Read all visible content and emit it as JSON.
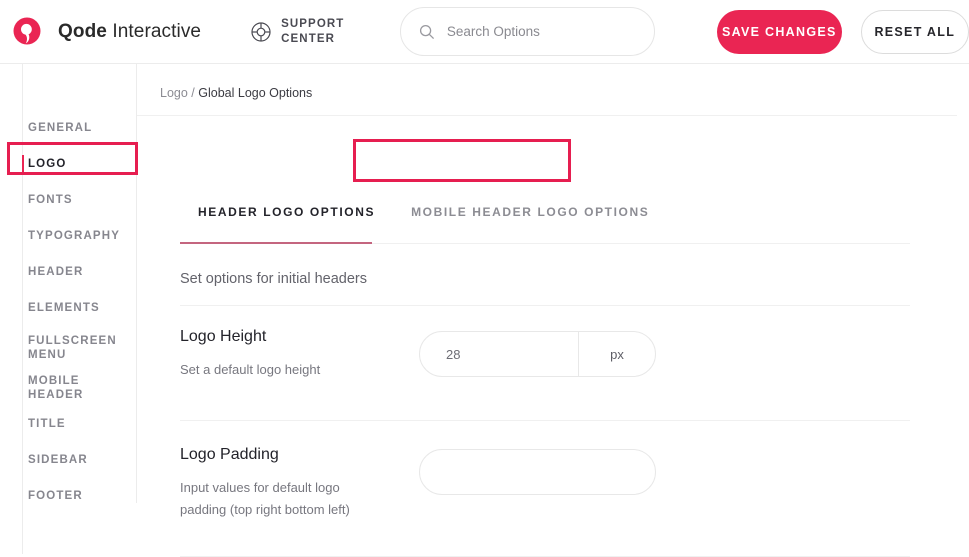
{
  "header": {
    "brand": {
      "bold": "Qode",
      "regular": " Interactive",
      "logo_icon": "qode-circle-logo",
      "logo_color": "#ea2553"
    },
    "support": {
      "label": "SUPPORT CENTER",
      "icon": "lifebuoy-icon"
    },
    "search": {
      "placeholder": "Search Options",
      "value": "",
      "icon": "search-icon"
    },
    "save_label": "SAVE CHANGES",
    "reset_label": "RESET ALL",
    "accent_color": "#ea2553"
  },
  "sidebar": {
    "items": [
      {
        "label": "GENERAL",
        "active": false
      },
      {
        "label": "LOGO",
        "active": true
      },
      {
        "label": "FONTS",
        "active": false
      },
      {
        "label": "TYPOGRAPHY",
        "active": false
      },
      {
        "label": "HEADER",
        "active": false
      },
      {
        "label": "ELEMENTS",
        "active": false
      },
      {
        "label": "FULLSCREEN MENU",
        "active": false
      },
      {
        "label": "MOBILE HEADER",
        "active": false
      },
      {
        "label": "TITLE",
        "active": false
      },
      {
        "label": "SIDEBAR",
        "active": false
      },
      {
        "label": "FOOTER",
        "active": false
      }
    ]
  },
  "breadcrumb": {
    "parent": "Logo",
    "separator": "/",
    "current": "Global Logo Options"
  },
  "tabs": [
    {
      "label": "HEADER LOGO OPTIONS",
      "active": true
    },
    {
      "label": "MOBILE HEADER LOGO OPTIONS",
      "active": false
    }
  ],
  "content": {
    "section_description": "Set options for initial headers",
    "fields": [
      {
        "label": "Logo Height",
        "help": "Set a default logo height",
        "value": "28",
        "unit": "px",
        "has_unit": true
      },
      {
        "label": "Logo Padding",
        "help": "Input values for default logo padding (top right bottom left)",
        "value": "",
        "unit": "",
        "has_unit": false
      }
    ]
  },
  "annotations": {
    "color": "#e61e50",
    "boxes": [
      {
        "name": "sidebar-logo-highlight"
      },
      {
        "name": "mobile-header-logo-options-tab-highlight"
      }
    ]
  }
}
